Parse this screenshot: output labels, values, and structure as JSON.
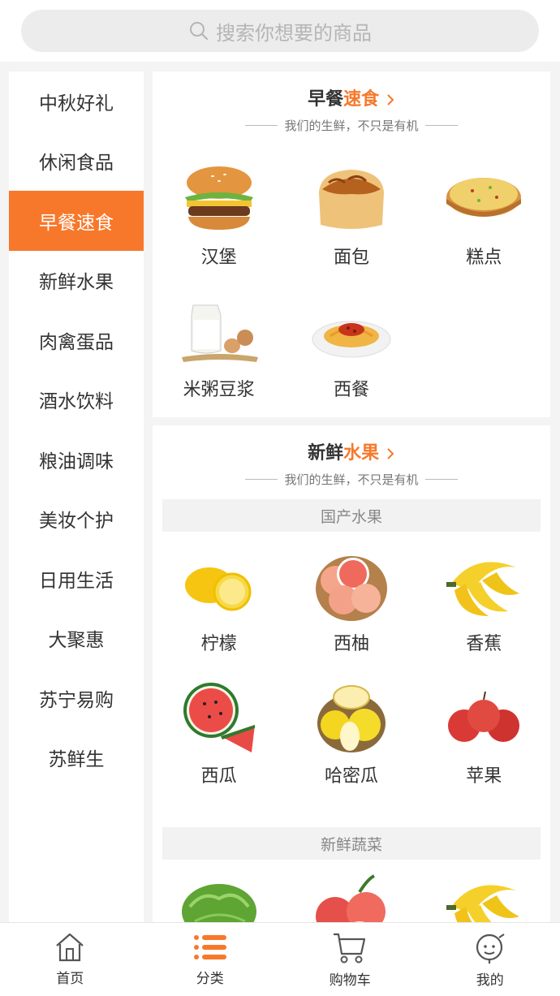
{
  "search": {
    "placeholder": "搜索你想要的商品"
  },
  "sidebar": {
    "items": [
      {
        "label": "中秋好礼"
      },
      {
        "label": "休闲食品"
      },
      {
        "label": "早餐速食"
      },
      {
        "label": "新鲜水果"
      },
      {
        "label": "肉禽蛋品"
      },
      {
        "label": "酒水饮料"
      },
      {
        "label": "粮油调味"
      },
      {
        "label": "美妆个护"
      },
      {
        "label": "日用生活"
      },
      {
        "label": "大聚惠"
      },
      {
        "label": "苏宁易购"
      },
      {
        "label": "苏鲜生"
      }
    ],
    "active_index": 2
  },
  "sections": [
    {
      "title_prefix": "早餐",
      "title_accent": "速食",
      "subtitle": "我们的生鲜，不只是有机",
      "items": [
        {
          "label": "汉堡",
          "icon": "burger-icon"
        },
        {
          "label": "面包",
          "icon": "bread-icon"
        },
        {
          "label": "糕点",
          "icon": "pastry-icon"
        },
        {
          "label": "米粥豆浆",
          "icon": "milk-icon"
        },
        {
          "label": "西餐",
          "icon": "pasta-icon"
        }
      ]
    },
    {
      "title_prefix": "新鲜",
      "title_accent": "水果",
      "subtitle": "我们的生鲜，不只是有机",
      "groups": [
        {
          "header": "国产水果",
          "items": [
            {
              "label": "柠檬",
              "icon": "lemon-icon"
            },
            {
              "label": "西柚",
              "icon": "grapefruit-icon"
            },
            {
              "label": "香蕉",
              "icon": "banana-icon"
            },
            {
              "label": "西瓜",
              "icon": "watermelon-icon"
            },
            {
              "label": "哈密瓜",
              "icon": "melon-icon"
            },
            {
              "label": "苹果",
              "icon": "apple-icon"
            }
          ]
        },
        {
          "header": "新鲜蔬菜",
          "items": [
            {
              "label": "",
              "icon": "lettuce-icon"
            },
            {
              "label": "",
              "icon": "peach-icon"
            },
            {
              "label": "",
              "icon": "banana-icon"
            }
          ]
        }
      ]
    }
  ],
  "tabbar": {
    "items": [
      {
        "label": "首页",
        "icon": "home-icon"
      },
      {
        "label": "分类",
        "icon": "category-icon"
      },
      {
        "label": "购物车",
        "icon": "cart-icon"
      },
      {
        "label": "我的",
        "icon": "profile-icon"
      }
    ],
    "active_index": 1
  },
  "colors": {
    "accent": "#f7782a",
    "background": "#f4f4f4"
  }
}
